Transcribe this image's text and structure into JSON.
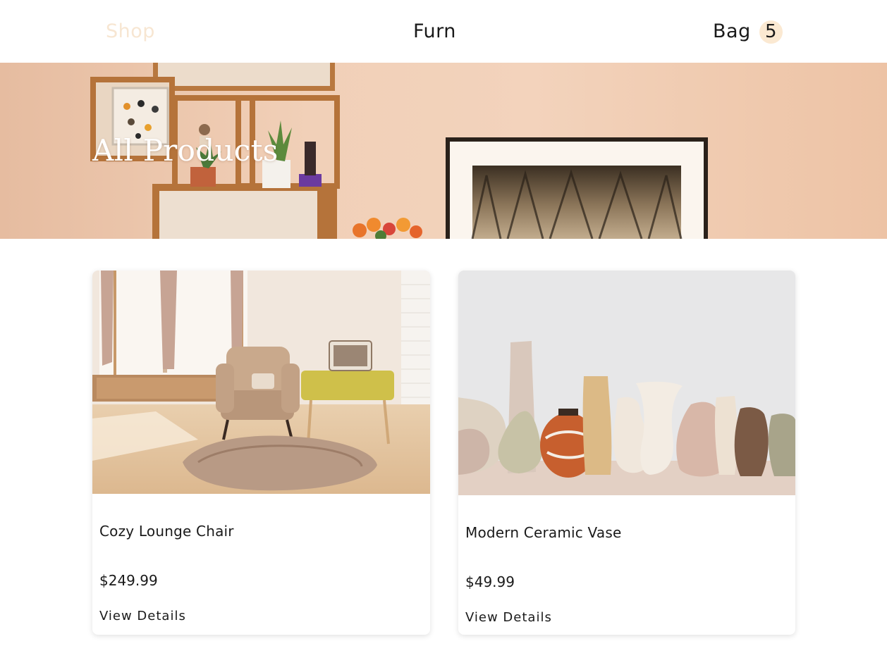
{
  "nav": {
    "shop_label": "Shop",
    "brand_label": "Furn",
    "bag_label": "Bag",
    "bag_count": "5"
  },
  "hero": {
    "title": "All Products"
  },
  "products": [
    {
      "name": "Cozy Lounge Chair",
      "price": "$249.99",
      "link_label": "View Details",
      "image": "living-room-armchair-photo"
    },
    {
      "name": "Modern Ceramic Vase",
      "price": "$49.99",
      "link_label": "View Details",
      "image": "ceramic-vases-photo"
    }
  ],
  "colors": {
    "accent": "#fbe9d2",
    "shop_link": "#f7e6d2",
    "text": "#1a1a1a"
  }
}
